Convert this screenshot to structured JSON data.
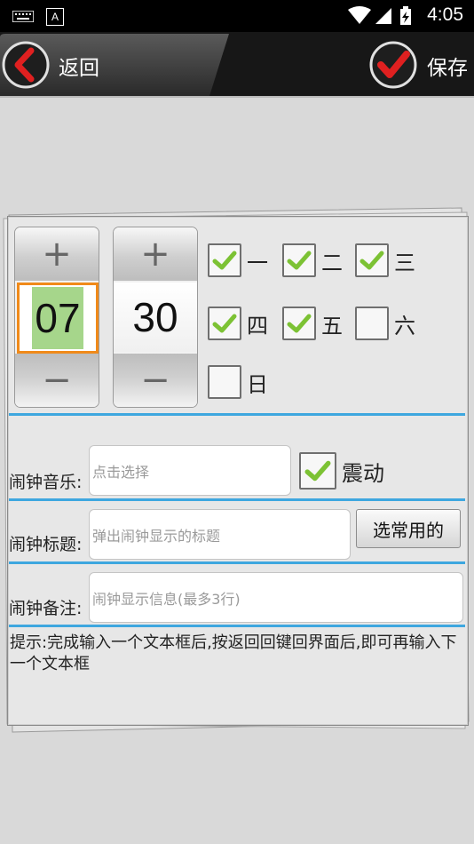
{
  "status_bar": {
    "time": "4:05",
    "icons": [
      "keyboard-icon",
      "a-notification-icon",
      "wifi-icon",
      "cellular-signal-icon",
      "battery-charging-icon"
    ]
  },
  "app_bar": {
    "back_label": "返回",
    "save_label": "保存",
    "accent_color": "#d81f1f"
  },
  "time_picker": {
    "hour": "07",
    "minute": "30",
    "plus_symbol": "+",
    "minus_symbol": "−"
  },
  "weekdays": [
    {
      "label": "一",
      "checked": true
    },
    {
      "label": "二",
      "checked": true
    },
    {
      "label": "三",
      "checked": true
    },
    {
      "label": "四",
      "checked": true
    },
    {
      "label": "五",
      "checked": true
    },
    {
      "label": "六",
      "checked": false
    },
    {
      "label": "日",
      "checked": false
    }
  ],
  "form": {
    "music_label": "闹钟音乐:",
    "music_placeholder": "点击选择",
    "vibrate_label": "震动",
    "vibrate_checked": true,
    "title_label": "闹钟标题:",
    "title_placeholder": "弹出闹钟显示的标题",
    "choose_common_label": "选常用的",
    "note_label": "闹钟备注:",
    "note_placeholder": "闹钟显示信息(最多3行)"
  },
  "hint": "提示:完成输入一个文本框后,按返回回键回界面后,即可再输入下一个文本框",
  "colors": {
    "divider": "#3ea7df",
    "hour_highlight": "#a6d68b",
    "hour_border": "#f08a1a",
    "check_green": "#7cc234"
  }
}
